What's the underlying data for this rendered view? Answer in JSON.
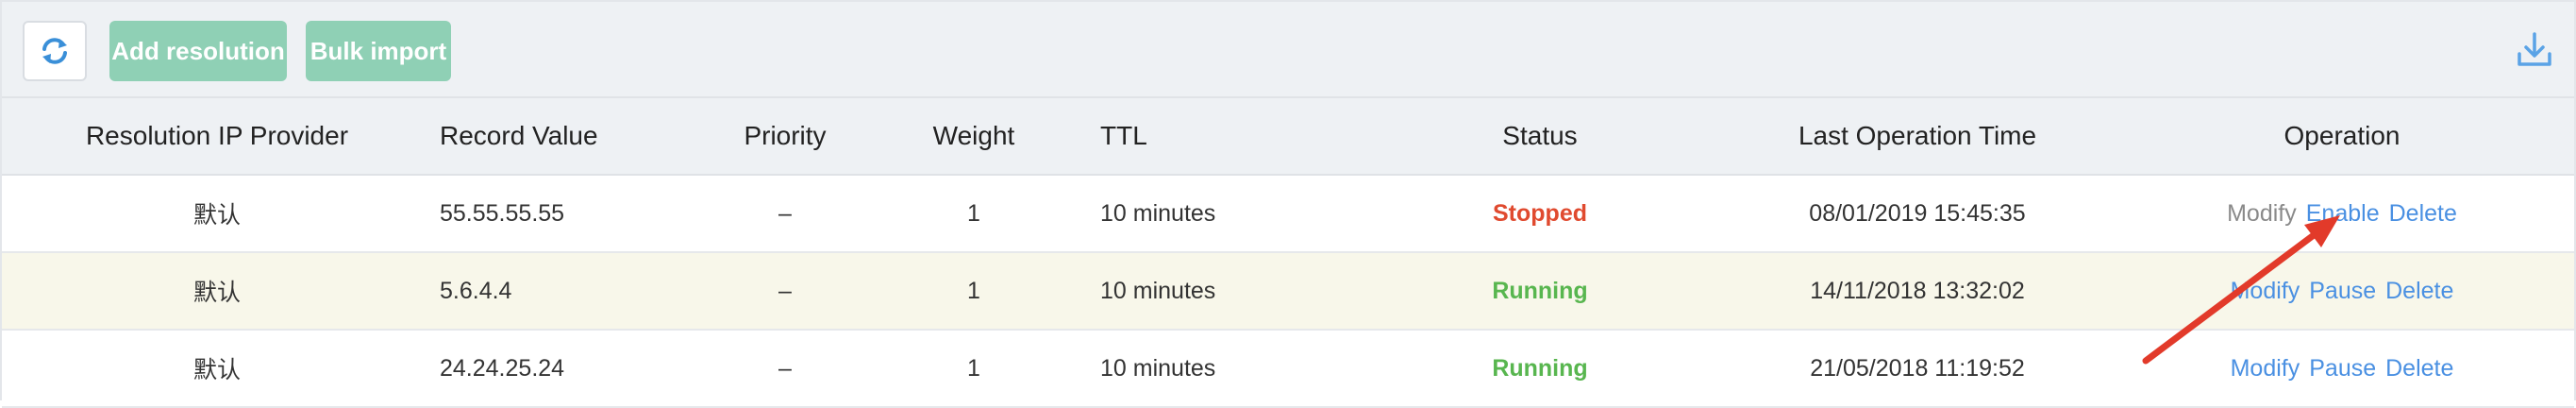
{
  "toolbar": {
    "refresh_icon": "refresh-icon",
    "add_label": "Add resolution",
    "bulk_label": "Bulk import",
    "download_icon": "download-icon"
  },
  "table": {
    "headers": [
      "Resolution IP Provider",
      "Record Value",
      "Priority",
      "Weight",
      "TTL",
      "Status",
      "Last Operation Time",
      "Operation"
    ],
    "rows": [
      {
        "provider": "默认",
        "record": "55.55.55.55",
        "priority": "–",
        "weight": "1",
        "ttl": "10 minutes",
        "status": "Stopped",
        "time": "08/01/2019 15:45:35",
        "ops": [
          "Modify",
          "Enable",
          "Delete"
        ]
      },
      {
        "provider": "默认",
        "record": "5.6.4.4",
        "priority": "–",
        "weight": "1",
        "ttl": "10 minutes",
        "status": "Running",
        "time": "14/11/2018 13:32:02",
        "ops": [
          "Modify",
          "Pause",
          "Delete"
        ]
      },
      {
        "provider": "默认",
        "record": "24.24.25.24",
        "priority": "–",
        "weight": "1",
        "ttl": "10 minutes",
        "status": "Running",
        "time": "21/05/2018 11:19:52",
        "ops": [
          "Modify",
          "Pause",
          "Delete"
        ]
      }
    ]
  },
  "colors": {
    "accent_green": "#8fd0b5",
    "link_blue": "#4a90e2",
    "stopped_red": "#e04a2f",
    "running_green": "#58b64f",
    "annotation_arrow": "#e23a2a"
  }
}
